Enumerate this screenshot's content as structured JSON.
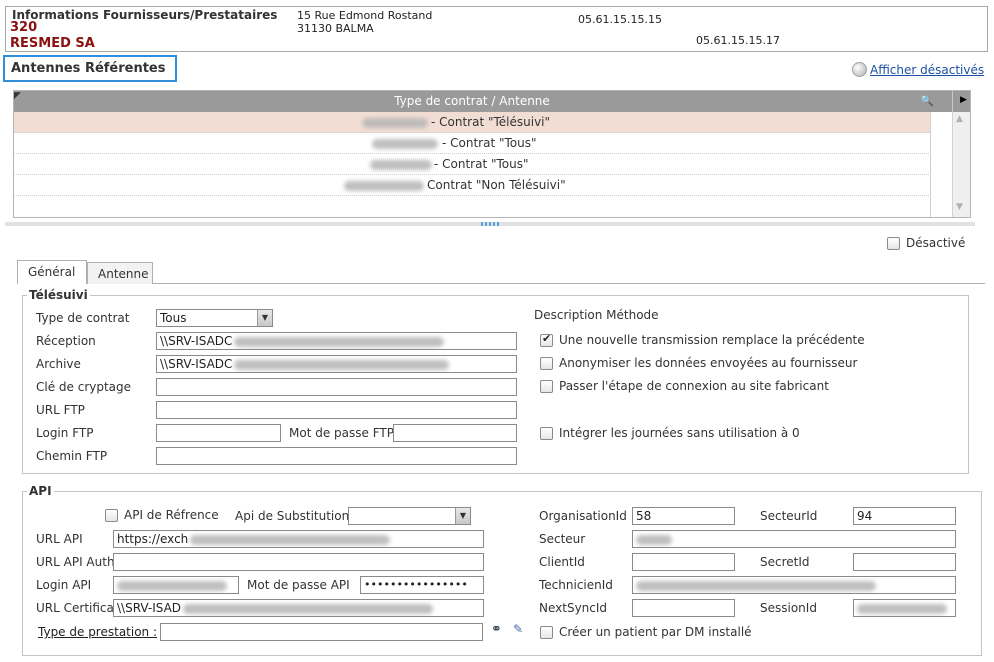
{
  "supplier": {
    "title": "Informations Fournisseurs/Prestataires",
    "code": "320",
    "name": "RESMED SA",
    "address_line1": "15 Rue Edmond Rostand",
    "address_line2": "31130 BALMA",
    "phone": "05.61.15.15.15",
    "fax": "05.61.15.15.17"
  },
  "antennes": {
    "title": "Antennes Référentes",
    "show_disabled": "Afficher désactivés",
    "column_header": "Type de contrat / Antenne",
    "rows": [
      {
        "text": "- Contrat \"Télésuivi\"",
        "selected": true
      },
      {
        "text": "- Contrat \"Tous\"",
        "selected": false
      },
      {
        "text": "- Contrat \"Tous\"",
        "selected": false
      },
      {
        "text": "Contrat \"Non Télésuivi\"",
        "selected": false
      }
    ]
  },
  "desactive_label": "Désactivé",
  "tabs": [
    {
      "label": "Général",
      "active": true
    },
    {
      "label": "Antenne",
      "active": false
    }
  ],
  "telesuivi": {
    "legend": "Télésuivi",
    "type_contrat_label": "Type de contrat",
    "type_contrat_value": "Tous",
    "reception_label": "Réception",
    "reception_value": "\\\\SRV-ISADC",
    "archive_label": "Archive",
    "archive_value": "\\\\SRV-ISADC",
    "cle_label": "Clé de cryptage",
    "url_ftp_label": "URL FTP",
    "login_ftp_label": "Login FTP",
    "mdp_ftp_label": "Mot de passe FTP",
    "chemin_ftp_label": "Chemin FTP",
    "description_label": "Description Méthode",
    "options": [
      {
        "label": "Une nouvelle transmission remplace la précédente",
        "checked": true
      },
      {
        "label": "Anonymiser les données envoyées au fournisseur",
        "checked": false
      },
      {
        "label": "Passer l'étape de connexion au site fabricant",
        "checked": false
      },
      {
        "label": "Intégrer les journées sans utilisation à 0",
        "checked": false
      }
    ]
  },
  "api": {
    "legend": "API",
    "api_ref_label": "API de Réfrence",
    "api_sub_label": "Api de Substitution",
    "url_api_label": "URL API",
    "url_api_value": "https://exch",
    "url_api_auth_label": "URL API Auth",
    "login_api_label": "Login API",
    "mdp_api_label": "Mot de passe API",
    "mdp_api_value": "••••••••••••••••",
    "url_cert_label": "URL Certificat",
    "url_cert_value": "\\\\SRV-ISAD",
    "type_prestation_label": "Type de prestation :",
    "organisation_label": "OrganisationId",
    "organisation_value": "58",
    "secteurid_label": "SecteurId",
    "secteurid_value": "94",
    "secteur_label": "Secteur",
    "client_label": "ClientId",
    "secret_label": "SecretId",
    "technicien_label": "TechnicienId",
    "nextsync_label": "NextSyncId",
    "session_label": "SessionId",
    "creer_patient_label": "Créer un patient par DM installé"
  }
}
